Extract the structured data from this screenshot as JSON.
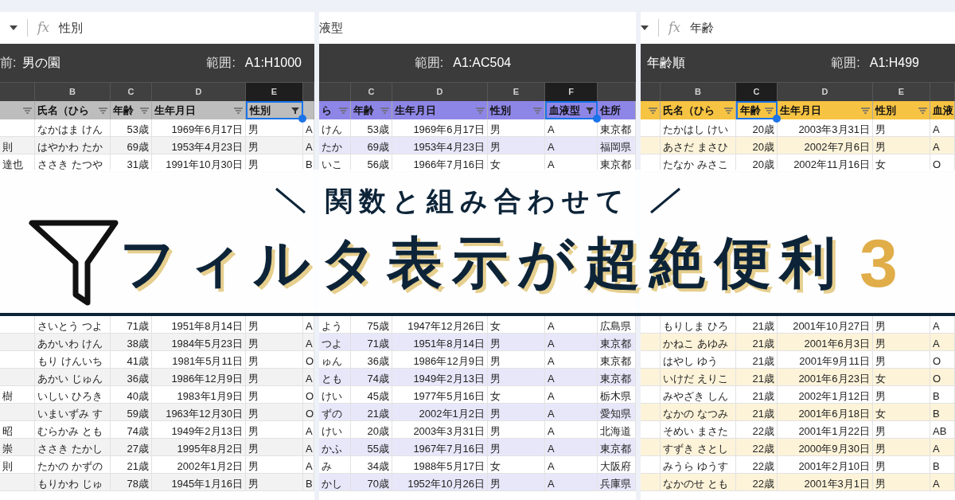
{
  "panels": [
    {
      "color": "#bdbdbd",
      "formula_bar": {
        "fx": "fx",
        "value": "性別"
      },
      "filter_bar": {
        "name_label": "前:",
        "name": "男の園",
        "range_label": "範囲:",
        "range": "A1:H1000"
      },
      "columns": [
        {
          "filter_icon": true,
          "filtered": false,
          "selected": false
        },
        {
          "letter": "B",
          "header": "氏名（ひら",
          "filter_icon": true,
          "filtered": false,
          "selected": false
        },
        {
          "letter": "C",
          "header": "年齢",
          "filter_icon": true,
          "filtered": false,
          "selected": false
        },
        {
          "letter": "D",
          "header": "生年月日",
          "filter_icon": true,
          "filtered": false,
          "selected": false
        },
        {
          "letter": "E",
          "header": "性別",
          "filter_icon": true,
          "filtered": true,
          "selected": true
        },
        {
          "filter_icon": false,
          "selected": false
        }
      ],
      "rows_above": [
        {
          "cells": [
            "なかはま けん",
            "53歳",
            "1969年6月17日",
            "男",
            "A"
          ]
        },
        {
          "lead": "則",
          "cells": [
            "はやかわ たか",
            "69歳",
            "1953年4月23日",
            "男",
            "A"
          ]
        },
        {
          "lead": "達也",
          "cells": [
            "ささき たつや",
            "31歳",
            "1991年10月30日",
            "男",
            "B"
          ]
        }
      ],
      "rows_below": [
        {
          "cells": [
            "さいとう つよ",
            "71歳",
            "1951年8月14日",
            "男",
            "A"
          ]
        },
        {
          "cells": [
            "あかいわ けん",
            "38歳",
            "1984年5月23日",
            "男",
            "A"
          ]
        },
        {
          "cells": [
            "もり けんいち",
            "41歳",
            "1981年5月11日",
            "男",
            "O"
          ]
        },
        {
          "cells": [
            "あかい じゅん",
            "36歳",
            "1986年12月9日",
            "男",
            "A"
          ]
        },
        {
          "lead": "樹",
          "cells": [
            "いしい ひろき",
            "40歳",
            "1983年1月9日",
            "男",
            "O"
          ]
        },
        {
          "cells": [
            "いまいずみ す",
            "59歳",
            "1963年12月30日",
            "男",
            "O"
          ]
        },
        {
          "lead": "昭",
          "cells": [
            "むらかみ とも",
            "74歳",
            "1949年2月13日",
            "男",
            "A"
          ]
        },
        {
          "lead": "崇",
          "cells": [
            "ささき たかし",
            "27歳",
            "1995年8月2日",
            "男",
            "A"
          ]
        },
        {
          "lead": "則",
          "cells": [
            "たかの かずの",
            "21歳",
            "2002年1月2日",
            "男",
            "A"
          ]
        },
        {
          "cells": [
            "もりかわ じゅ",
            "78歳",
            "1945年1月16日",
            "男",
            "B"
          ]
        }
      ]
    },
    {
      "color": "#8e86e6",
      "formula_bar": {
        "value": "液型"
      },
      "filter_bar": {
        "range_label": "範囲:",
        "range": "A1:AC504"
      },
      "columns": [
        {
          "header": "ら",
          "filter_icon": true,
          "filtered": false,
          "selected": false
        },
        {
          "letter": "C",
          "header": "年齢",
          "filter_icon": true,
          "filtered": false,
          "selected": false
        },
        {
          "letter": "D",
          "header": "生年月日",
          "filter_icon": true,
          "filtered": false,
          "selected": false
        },
        {
          "letter": "E",
          "header": "性別",
          "filter_icon": true,
          "filtered": false,
          "selected": false
        },
        {
          "letter": "F",
          "header": "血液型",
          "filter_icon": true,
          "filtered": true,
          "selected": true
        },
        {
          "header": "住所",
          "filter_icon": false,
          "selected": false
        }
      ],
      "rows_above": [
        {
          "cells": [
            "けん",
            "53歳",
            "1969年6月17日",
            "男",
            "A",
            "東京都"
          ]
        },
        {
          "cells": [
            "たか",
            "69歳",
            "1953年4月23日",
            "男",
            "A",
            "福岡県"
          ]
        },
        {
          "cells": [
            "いこ",
            "56歳",
            "1966年7月16日",
            "女",
            "A",
            "東京都"
          ]
        }
      ],
      "rows_below": [
        {
          "cells": [
            "よう",
            "75歳",
            "1947年12月26日",
            "女",
            "A",
            "広島県"
          ]
        },
        {
          "cells": [
            "つよ",
            "71歳",
            "1951年8月14日",
            "男",
            "A",
            "東京都"
          ]
        },
        {
          "cells": [
            "ゅん",
            "36歳",
            "1986年12月9日",
            "男",
            "A",
            "東京都"
          ]
        },
        {
          "cells": [
            "とも",
            "74歳",
            "1949年2月13日",
            "男",
            "A",
            "東京都"
          ]
        },
        {
          "cells": [
            "けい",
            "45歳",
            "1977年5月16日",
            "女",
            "A",
            "栃木県"
          ]
        },
        {
          "cells": [
            "ずの",
            "21歳",
            "2002年1月2日",
            "男",
            "A",
            "愛知県"
          ]
        },
        {
          "cells": [
            "けい",
            "20歳",
            "2003年3月31日",
            "男",
            "A",
            "北海道"
          ]
        },
        {
          "cells": [
            "かふ",
            "55歳",
            "1967年7月16日",
            "男",
            "A",
            "東京都"
          ]
        },
        {
          "cells": [
            "み",
            "34歳",
            "1988年5月17日",
            "女",
            "A",
            "大阪府"
          ]
        },
        {
          "cells": [
            "かし",
            "70歳",
            "1952年10月26日",
            "男",
            "A",
            "兵庫県"
          ]
        }
      ]
    },
    {
      "color": "#f6c343",
      "formula_bar": {
        "fx": "fx",
        "value": "年齢"
      },
      "filter_bar": {
        "name": "年齢順",
        "range_label": "範囲:",
        "range": "A1:H499"
      },
      "columns": [
        {
          "filter_icon": true,
          "filtered": false,
          "selected": false
        },
        {
          "letter": "B",
          "header": "氏名（ひら",
          "filter_icon": true,
          "filtered": false,
          "selected": false
        },
        {
          "letter": "C",
          "header": "年齢",
          "filter_icon": true,
          "filtered": false,
          "selected": true
        },
        {
          "letter": "D",
          "header": "生年月日",
          "filter_icon": true,
          "filtered": false,
          "selected": false
        },
        {
          "letter": "E",
          "header": "性別",
          "filter_icon": true,
          "filtered": false,
          "selected": false
        },
        {
          "header": "血液",
          "filter_icon": false,
          "selected": false
        }
      ],
      "rows_above": [
        {
          "cells": [
            "たかはし けい",
            "20歳",
            "2003年3月31日",
            "男",
            "A"
          ]
        },
        {
          "cells": [
            "あさだ まさひ",
            "20歳",
            "2002年7月6日",
            "男",
            "A"
          ]
        },
        {
          "cells": [
            "たなか みさこ",
            "20歳",
            "2002年11月16日",
            "女",
            "O"
          ]
        }
      ],
      "rows_below": [
        {
          "cells": [
            "もりしま ひろ",
            "21歳",
            "2001年10月27日",
            "男",
            "A"
          ]
        },
        {
          "cells": [
            "かねこ あゆみ",
            "21歳",
            "2001年6月3日",
            "男",
            "A"
          ]
        },
        {
          "cells": [
            "はやし ゆう",
            "21歳",
            "2001年9月11日",
            "男",
            "O"
          ]
        },
        {
          "cells": [
            "いけだ えりこ",
            "21歳",
            "2001年6月23日",
            "女",
            "O"
          ]
        },
        {
          "cells": [
            "みやざき しん",
            "21歳",
            "2002年1月12日",
            "男",
            "B"
          ]
        },
        {
          "cells": [
            "なかの なつみ",
            "21歳",
            "2001年6月18日",
            "女",
            "B"
          ]
        },
        {
          "cells": [
            "そめい まさた",
            "22歳",
            "2001年1月22日",
            "男",
            "AB"
          ]
        },
        {
          "cells": [
            "すずき さとし",
            "22歳",
            "2000年9月30日",
            "男",
            "A"
          ]
        },
        {
          "cells": [
            "みうら ゆうす",
            "22歳",
            "2001年2月10日",
            "男",
            "B"
          ]
        },
        {
          "cells": [
            "なかのせ とも",
            "22歳",
            "2001年3月1日",
            "男",
            "A"
          ]
        }
      ]
    }
  ],
  "banner": {
    "subtitle": "関数と組み合わせて",
    "title": "フィルタ表示が超絶便利",
    "number": "3"
  }
}
